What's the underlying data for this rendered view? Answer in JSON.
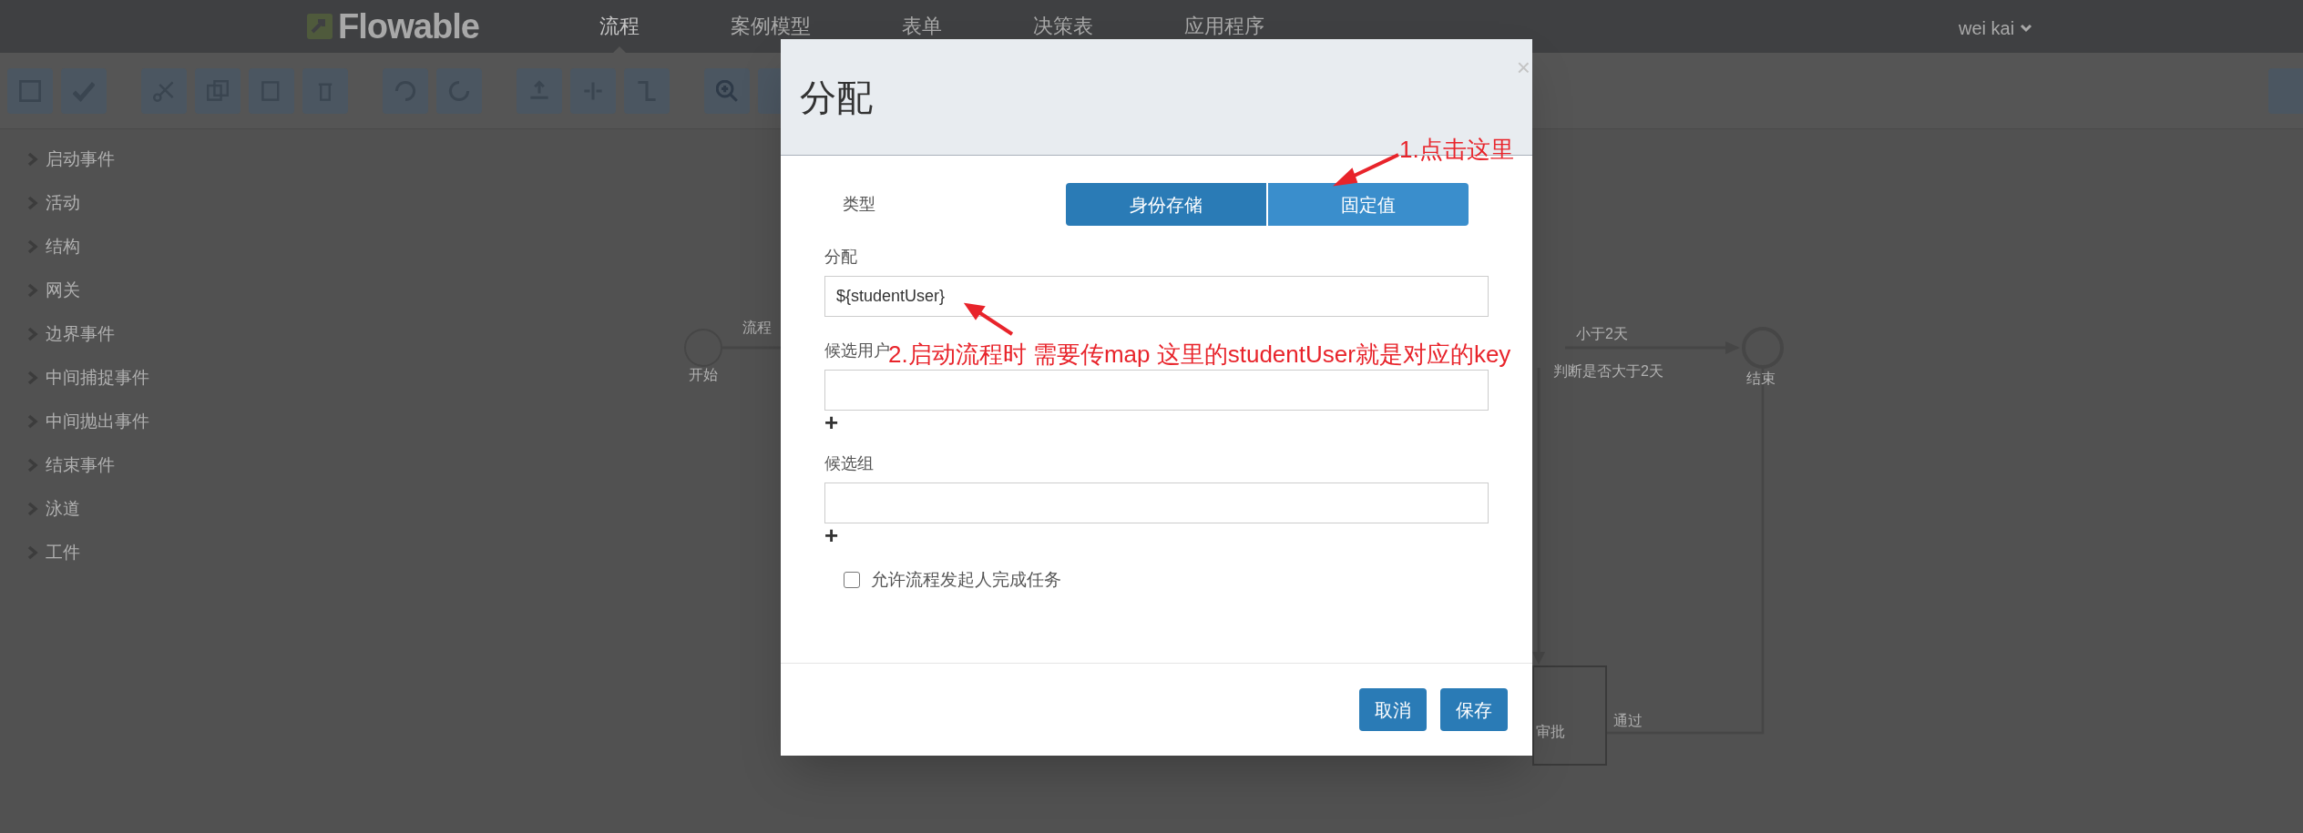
{
  "navbar": {
    "logo": "Flowable",
    "items": [
      {
        "label": "流程",
        "selected": true
      },
      {
        "label": "案例模型",
        "selected": false
      },
      {
        "label": "表单",
        "selected": false
      },
      {
        "label": "决策表",
        "selected": false
      },
      {
        "label": "应用程序",
        "selected": false
      }
    ],
    "user": "wei kai"
  },
  "palette": {
    "items": [
      {
        "label": "启动事件"
      },
      {
        "label": "活动"
      },
      {
        "label": "结构"
      },
      {
        "label": "网关"
      },
      {
        "label": "边界事件"
      },
      {
        "label": "中间捕捉事件"
      },
      {
        "label": "中间抛出事件"
      },
      {
        "label": "结束事件"
      },
      {
        "label": "泳道"
      },
      {
        "label": "工件"
      }
    ]
  },
  "diagram": {
    "start_label": "开始",
    "start_flow_label": "流程",
    "lt_flow_label": "小于2天",
    "gateway_label": "判断是否大于2天",
    "end_label": "结束",
    "pass_flow_label": "通过",
    "task_label": "审批"
  },
  "dialog": {
    "title": "分配",
    "close": "×",
    "type_label": "类型",
    "type_options": [
      {
        "label": "身份存储",
        "selected": true
      },
      {
        "label": "固定值",
        "selected": false
      }
    ],
    "assignee": {
      "label": "分配",
      "value": "${studentUser}"
    },
    "candidate_users": {
      "label": "候选用户",
      "add": "+"
    },
    "candidate_groups": {
      "label": "候选组",
      "add": "+"
    },
    "initiator_can_complete": {
      "label": "允许流程发起人完成任务",
      "checked": false
    },
    "buttons": [
      "取消",
      "保存"
    ]
  },
  "annotations": [
    "1.点击这里",
    "2.启动流程时 需要传map 这里的studentUser就是对应的key"
  ]
}
